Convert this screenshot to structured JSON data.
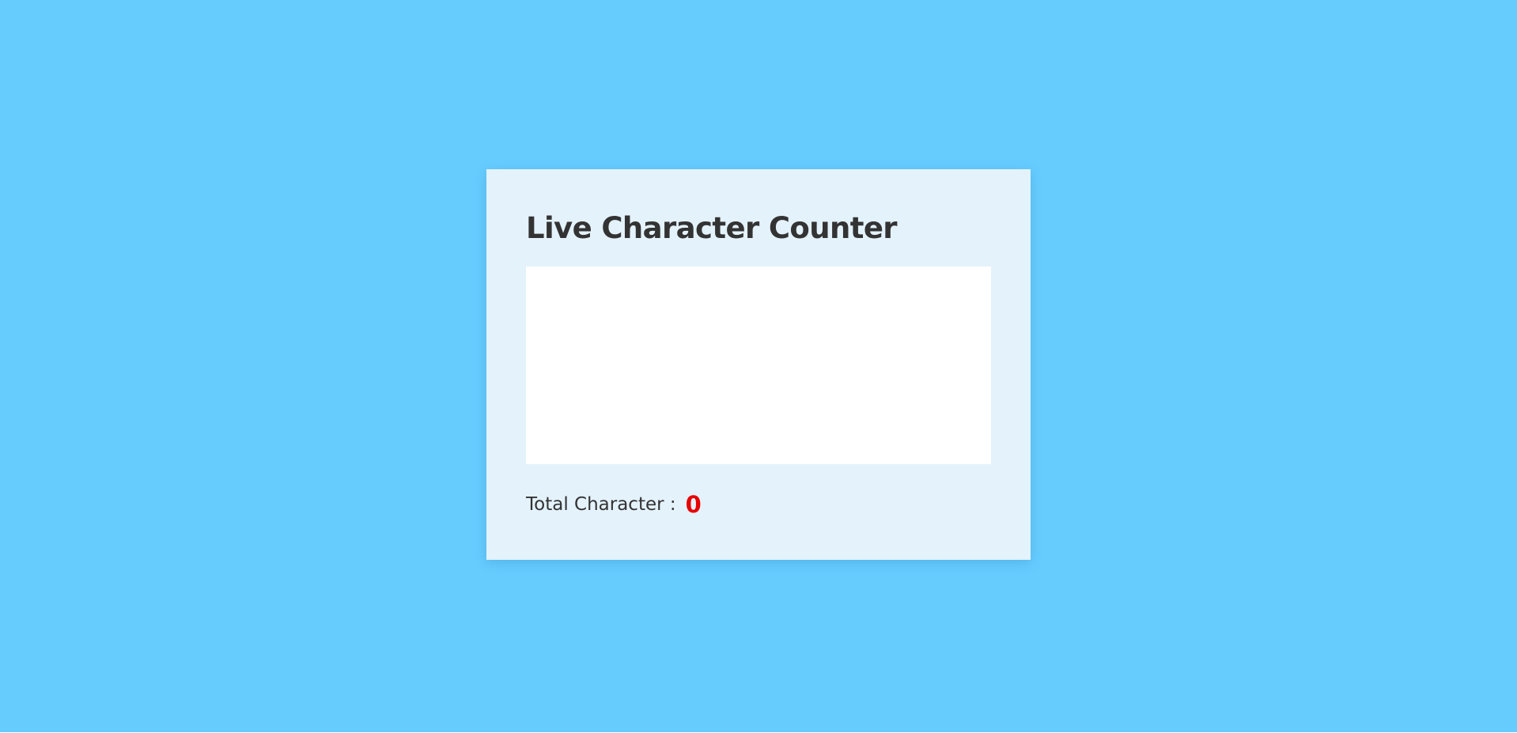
{
  "page": {
    "background_color": "#66ccfe",
    "card_color": "#e4f2fc"
  },
  "card": {
    "title": "Live Character Counter",
    "textarea": {
      "value": "",
      "placeholder": ""
    },
    "counter": {
      "label": "Total Character :",
      "value": "0",
      "value_color": "#e60000"
    }
  }
}
